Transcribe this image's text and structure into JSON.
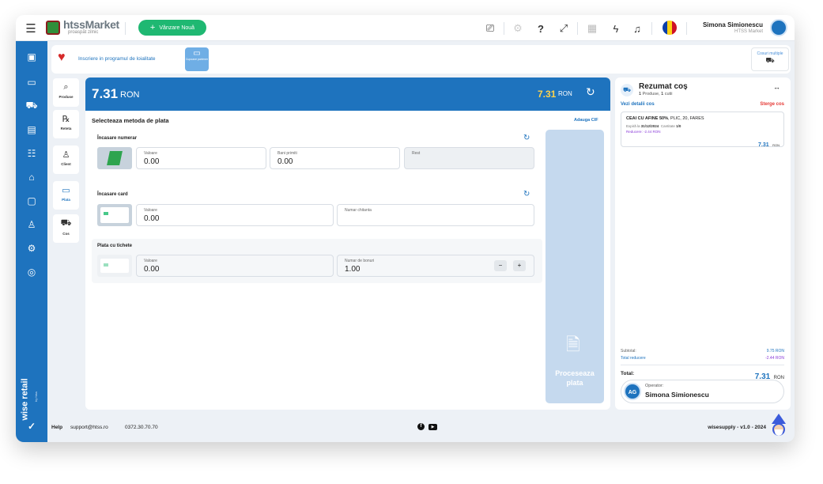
{
  "header": {
    "logo_text": "htssMarket",
    "logo_tagline": "proaspăt zilnic",
    "new_sale_label": "Vânzare Nouă",
    "user_name": "Simona Simionescu",
    "user_store": "HTSS Market"
  },
  "promo": {
    "loyalty_label": "Inscriere in programul de loialitate",
    "coupons_label": "Cupoane partener",
    "multiple_carts_label": "Cosuri multiple"
  },
  "tabs": [
    {
      "label": "Produse",
      "icon": "search-icon"
    },
    {
      "label": "Reteta",
      "icon": "prescription-icon"
    },
    {
      "label": "Client",
      "icon": "person-icon"
    },
    {
      "label": "Plata",
      "icon": "card-icon"
    },
    {
      "label": "Cos",
      "icon": "cart-icon"
    }
  ],
  "payment": {
    "amount": "7.31",
    "currency": "RON",
    "amount_right": "7.31",
    "currency_right": "RON",
    "section_title": "Selecteaza metoda de plata",
    "add_cif": "Adauga CIF",
    "cash": {
      "title": "Încasare numerar",
      "value_label": "Valoare",
      "value": "0.00",
      "received_label": "Bani primiti",
      "received": "0.00",
      "change_label": "Rest"
    },
    "card": {
      "title": "Încasare card",
      "value_label": "Valoare",
      "value": "0.00",
      "receipt_label": "Numar chitanta"
    },
    "voucher": {
      "title": "Plata cu tichete",
      "value_label": "Valoare",
      "value": "0.00",
      "count_label": "Numar de bonuri",
      "count": "1.00",
      "minus": "−",
      "plus": "+"
    },
    "process_label": "Proceseaza plata"
  },
  "cart": {
    "title": "Rezumat coș",
    "products_count": "1",
    "products_word": "Produse,",
    "boxes_count": "1",
    "boxes_word": "cutii",
    "details_link": "Vezi detalii cos",
    "delete_link": "Sterge cos",
    "item": {
      "name": "CEAI CU AFINE 50%",
      "details": ", PLIC, 20, FARES",
      "expiry_label": "Expiră la",
      "expiry": "31/12/2024",
      "qty_label": "Cantitate",
      "qty": "1/0",
      "discount": "Reducere: -2.44 RON",
      "price": "7.31",
      "price_currency": "RON"
    },
    "subtotal_label": "Subtotal:",
    "subtotal": "9.75 RON",
    "discount_label": "Total reducere",
    "discount_total": "-2.44 RON",
    "total_label": "Total:",
    "total": "7.31",
    "total_currency": "RON",
    "operator_label": "Operator:",
    "operator_initials": "AG",
    "operator_name": "Simona Simionescu"
  },
  "footer": {
    "help": "Help",
    "email": "support@htss.ro",
    "phone": "0372.30.70.70",
    "version": "wisesupply - v1.0 - 2024"
  },
  "brand": {
    "name": "wise retail",
    "by": "by htss"
  },
  "colors": {
    "primary": "#1e73be",
    "accent_green": "#1fb872",
    "price_yellow": "#ffd34d",
    "discount_purple": "#8a3bd8",
    "danger_red": "#e53935"
  }
}
